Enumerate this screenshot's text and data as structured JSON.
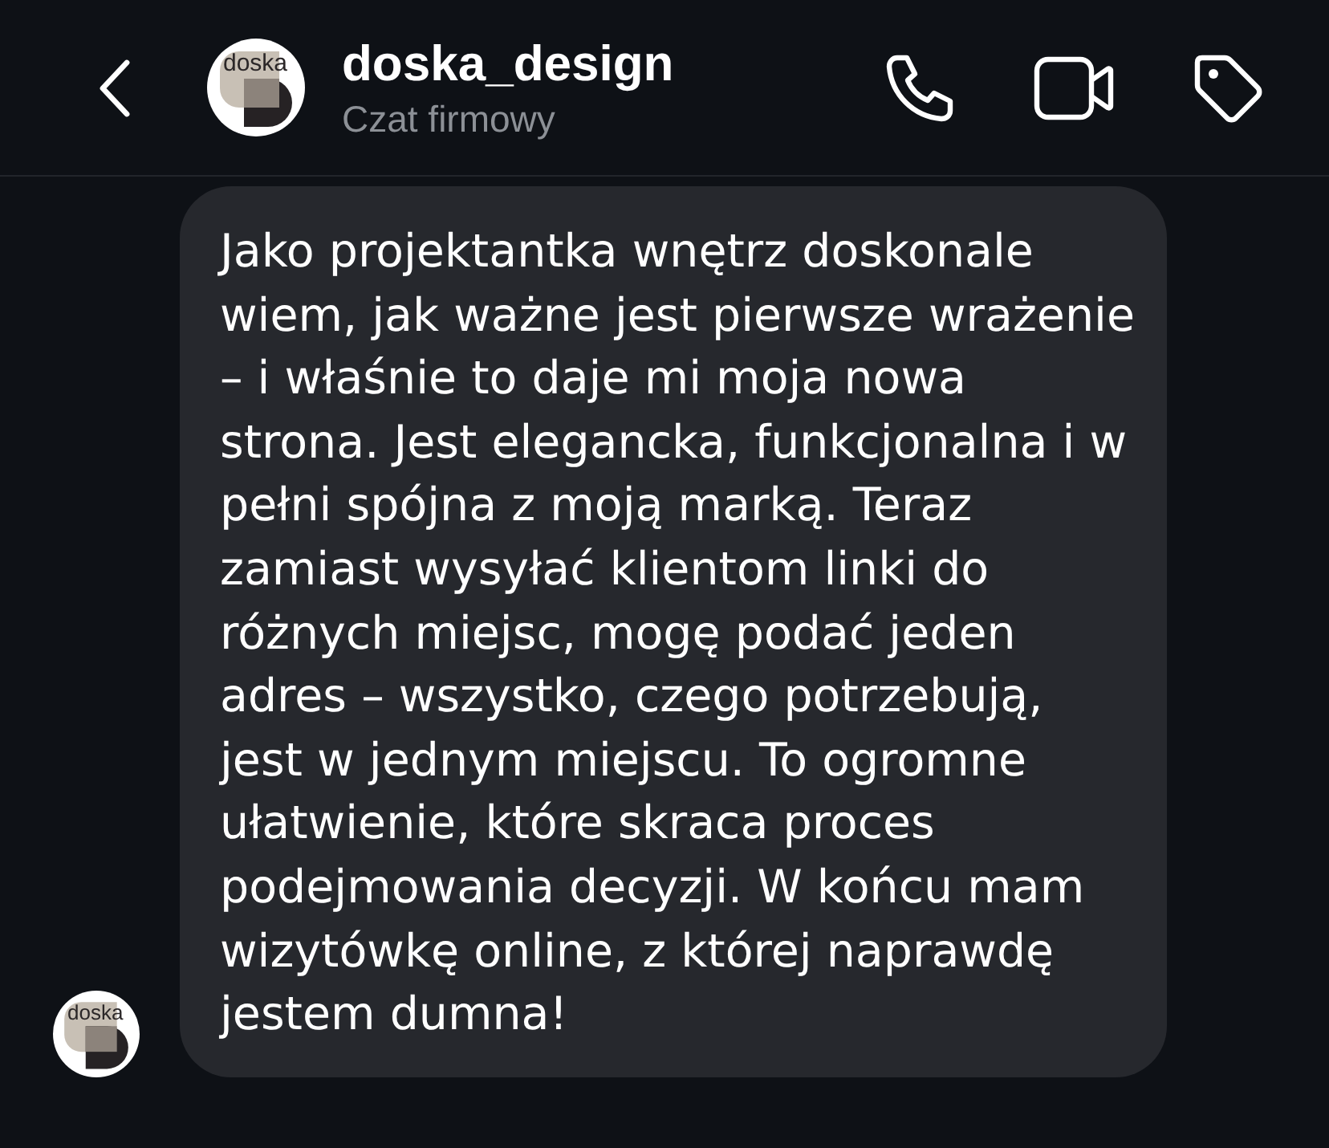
{
  "header": {
    "name": "doska_design",
    "subtitle": "Czat firmowy",
    "logo_text": "doska"
  },
  "message": {
    "text": "Jako projektantka wnętrz doskonale wiem, jak ważne jest pierwsze wrażenie – i właśnie to daje mi moja nowa strona. Jest elegancka, funkcjonalna i w pełni spójna z moją marką. Teraz zamiast wysyłać klientom linki do różnych miejsc, mogę podać jeden adres – wszystko, czego potrzebują, jest w jednym miejscu. To ogromne ułatwienie, które skraca proces podejmowania decyzji. W końcu mam wizytówkę online, z której naprawdę jestem dumna!",
    "logo_text": "doska"
  }
}
